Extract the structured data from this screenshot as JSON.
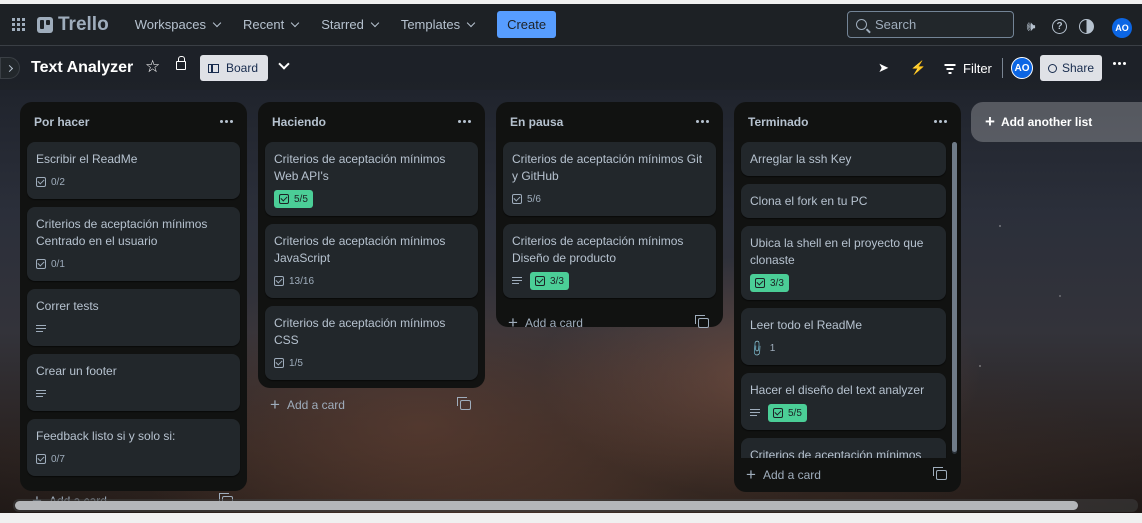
{
  "nav": {
    "brand": "Trello",
    "menu": [
      "Workspaces",
      "Recent",
      "Starred",
      "Templates"
    ],
    "create_label": "Create",
    "search_placeholder": "Search",
    "user_initials": "AO"
  },
  "board": {
    "title": "Text Analyzer",
    "view_label": "Board",
    "filter_label": "Filter",
    "member_initials": "AO",
    "share_label": "Share"
  },
  "lists": [
    {
      "title": "Por hacer",
      "add_card_label": "Add a card",
      "cards": [
        {
          "title": "Escribir el ReadMe",
          "checklist": "0/2"
        },
        {
          "title": "Criterios de aceptación mínimos Centrado en el usuario",
          "checklist": "0/1"
        },
        {
          "title": "Correr tests",
          "description": true
        },
        {
          "title": "Crear un footer",
          "description": true
        },
        {
          "title": "Feedback listo si y solo si:",
          "checklist": "0/7"
        }
      ]
    },
    {
      "title": "Haciendo",
      "add_card_label": "Add a card",
      "cards": [
        {
          "title": "Criterios de aceptación mínimos Web API's",
          "checklist": "5/5",
          "complete": true
        },
        {
          "title": "Criterios de aceptación mínimos JavaScript",
          "checklist": "13/16"
        },
        {
          "title": "Criterios de aceptación mínimos CSS",
          "checklist": "1/5"
        }
      ]
    },
    {
      "title": "En pausa",
      "add_card_label": "Add a card",
      "cards": [
        {
          "title": "Criterios de aceptación mínimos Git y GitHub",
          "checklist": "5/6"
        },
        {
          "title": "Criterios de aceptación mínimos Diseño de producto",
          "description": true,
          "checklist": "3/3",
          "complete": true
        }
      ]
    },
    {
      "title": "Terminado",
      "add_card_label": "Add a card",
      "cards": [
        {
          "title": "Arreglar la ssh Key"
        },
        {
          "title": "Clona el fork en tu PC"
        },
        {
          "title": "Ubica la shell en el proyecto que clonaste",
          "checklist": "3/3",
          "complete": true
        },
        {
          "title": "Leer todo el ReadMe",
          "attachments": "1"
        },
        {
          "title": "Hacer el diseño del text analyzer",
          "description": true,
          "checklist": "5/5",
          "complete": true
        },
        {
          "title": "Criterios de aceptación mínimos HTML"
        }
      ]
    }
  ],
  "add_list_label": "Add another list",
  "colors": {
    "accent": "#579dff",
    "complete_badge": "#4bce97",
    "list_bg": "#111211",
    "card_bg": "#22272b",
    "avatar": "#0c66e4"
  },
  "icons": [
    "apps-grid-icon",
    "trello-logo-icon",
    "search-icon",
    "megaphone-icon",
    "help-icon",
    "theme-icon",
    "star-icon",
    "lock-icon",
    "board-icon",
    "power-up-icon",
    "automation-icon",
    "filter-icon",
    "share-icon",
    "more-icon",
    "checklist-icon",
    "description-icon",
    "attachment-icon",
    "template-icon"
  ]
}
